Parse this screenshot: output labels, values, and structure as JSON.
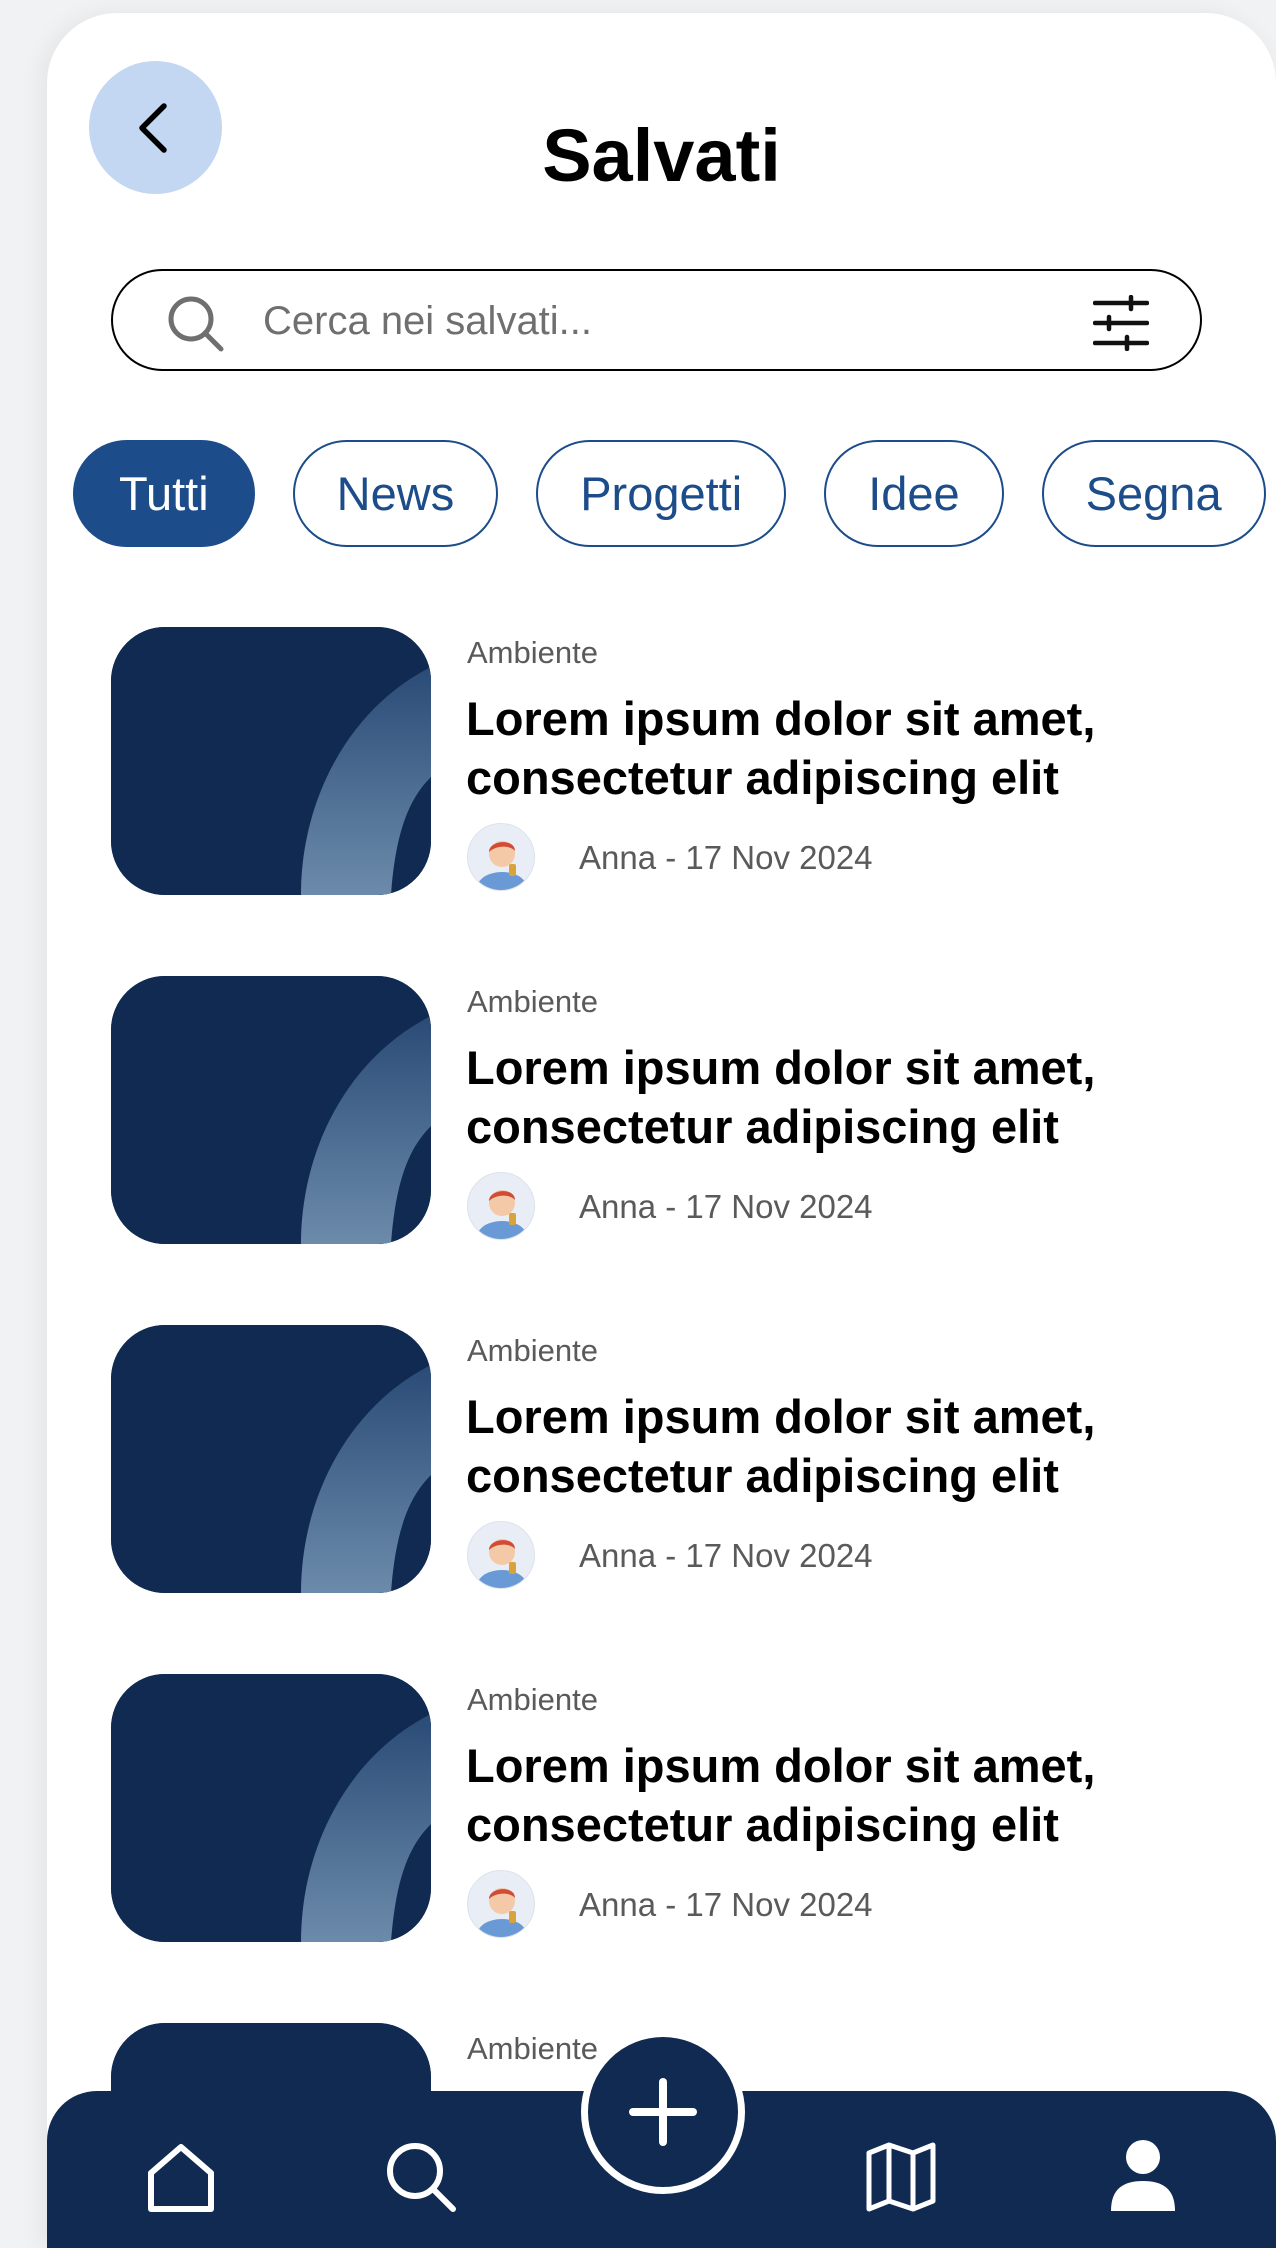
{
  "header": {
    "title": "Salvati"
  },
  "search": {
    "placeholder": "Cerca nei salvati..."
  },
  "chips": [
    "Tutti",
    "News",
    "Progetti",
    "Idee",
    "Segna"
  ],
  "items": [
    {
      "category": "Ambiente",
      "title": "Lorem ipsum dolor sit amet, consectetur adipiscing elit",
      "meta": "Anna - 17 Nov 2024"
    },
    {
      "category": "Ambiente",
      "title": "Lorem ipsum dolor sit amet, consectetur adipiscing elit",
      "meta": "Anna - 17 Nov 2024"
    },
    {
      "category": "Ambiente",
      "title": "Lorem ipsum dolor sit amet, consectetur adipiscing elit",
      "meta": "Anna - 17 Nov 2024"
    },
    {
      "category": "Ambiente",
      "title": "Lorem ipsum dolor sit amet, consectetur adipiscing elit",
      "meta": "Anna - 17 Nov 2024"
    },
    {
      "category": "Ambiente",
      "title": "",
      "meta": ""
    }
  ],
  "nav": {
    "items": [
      "home-icon",
      "search-icon",
      "add-icon",
      "map-icon",
      "profile-icon"
    ]
  },
  "colors": {
    "primary": "#1c4c8a",
    "navy": "#102a52",
    "back_button_bg": "#c3d6f2"
  }
}
